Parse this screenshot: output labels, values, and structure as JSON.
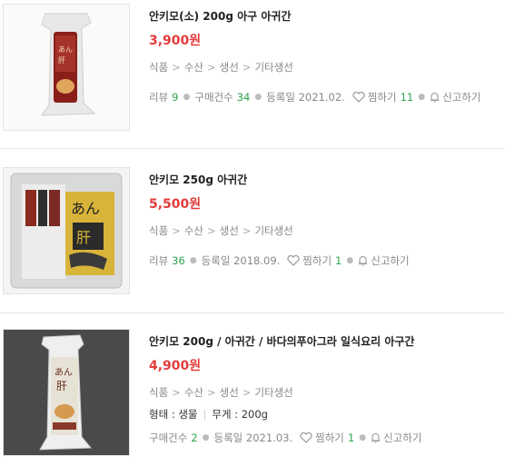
{
  "items": [
    {
      "title": "안키모(소) 200g 아구 아귀간",
      "price": "3,900원",
      "categories": [
        "식품",
        "수산",
        "생선",
        "기타생선"
      ],
      "meta": {
        "review_label": "리뷰",
        "review_count": "9",
        "purchase_label": "구매건수",
        "purchase_count": "34",
        "date_label": "등록일",
        "date": "2021.02.",
        "like_label": "찜하기",
        "like_count": "11",
        "report_label": "신고하기"
      }
    },
    {
      "title": "안키모 250g 아귀간",
      "price": "5,500원",
      "categories": [
        "식품",
        "수산",
        "생선",
        "기타생선"
      ],
      "meta": {
        "review_label": "리뷰",
        "review_count": "36",
        "date_label": "등록일",
        "date": "2018.09.",
        "like_label": "찜하기",
        "like_count": "1",
        "report_label": "신고하기"
      }
    },
    {
      "title": "안키모 200g / 아귀간 / 바다의푸아그라 일식요리 아구간",
      "price": "4,900원",
      "categories": [
        "식품",
        "수산",
        "생선",
        "기타생선"
      ],
      "spec": {
        "form_label": "형태 : 생물",
        "weight_label": "무게 : 200g"
      },
      "meta": {
        "purchase_label": "구매건수",
        "purchase_count": "2",
        "date_label": "등록일",
        "date": "2021.03.",
        "like_label": "찜하기",
        "like_count": "1",
        "report_label": "신고하기"
      }
    }
  ],
  "colors": {
    "price": "#e33c3c",
    "count": "#2ea44f",
    "muted": "#888888"
  },
  "category_separator": ">"
}
